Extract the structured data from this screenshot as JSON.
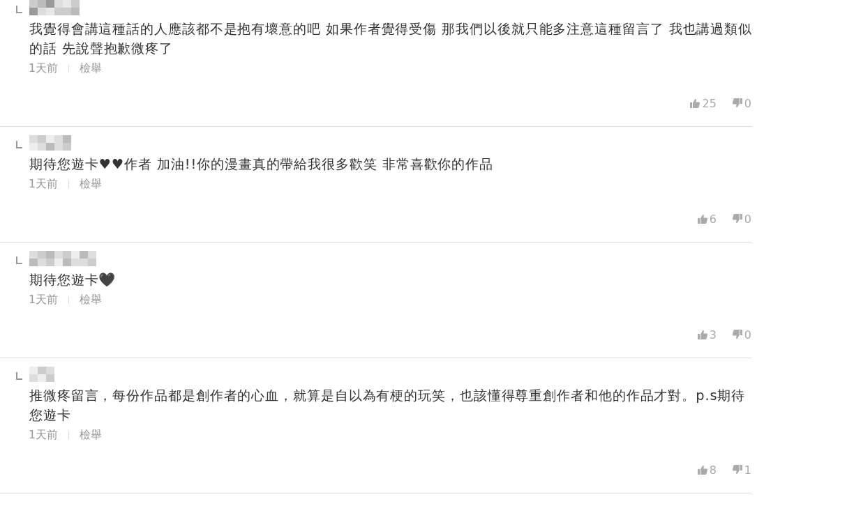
{
  "comments": [
    {
      "text": "我覺得會講這種話的人應該都不是抱有壞意的吧 如果作者覺得受傷 那我們以後就只能多注意這種留言了 我也講過類似的話 先說聲抱歉微疼了",
      "time": "1天前",
      "report": "檢舉",
      "likes": "25",
      "dislikes": "0"
    },
    {
      "text": "期待您遊卡♥♥作者 加油!!你的漫畫真的帶給我很多歡笑 非常喜歡你的作品",
      "time": "1天前",
      "report": "檢舉",
      "likes": "6",
      "dislikes": "0"
    },
    {
      "text": "期待您遊卡🖤",
      "time": "1天前",
      "report": "檢舉",
      "likes": "3",
      "dislikes": "0"
    },
    {
      "text": "推微疼留言，每份作品都是創作者的心血，就算是自以為有梗的玩笑，也該懂得尊重創作者和他的作品才對。p.s期待您遊卡",
      "time": "1天前",
      "report": "檢舉",
      "likes": "8",
      "dislikes": "1"
    }
  ]
}
